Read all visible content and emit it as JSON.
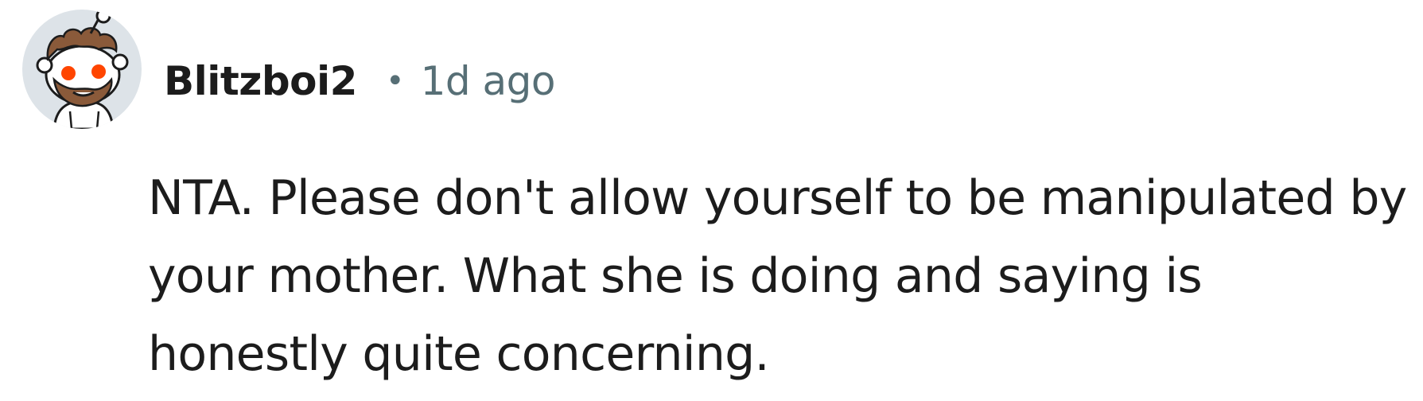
{
  "comment": {
    "username": "Blitzboi2",
    "separator": "•",
    "timestamp": "1d ago",
    "body": "NTA. Please don't allow yourself to be manipulated by your mother. What she is doing and saying is honestly quite concerning."
  },
  "avatar": {
    "icon": "snoo-avatar-icon",
    "background_color": "#dde3e8",
    "hair_color": "#8a5a3a",
    "eye_color": "#ff4500"
  },
  "colors": {
    "text_primary": "#1c1c1c",
    "text_secondary": "#576f76",
    "background": "#ffffff"
  }
}
